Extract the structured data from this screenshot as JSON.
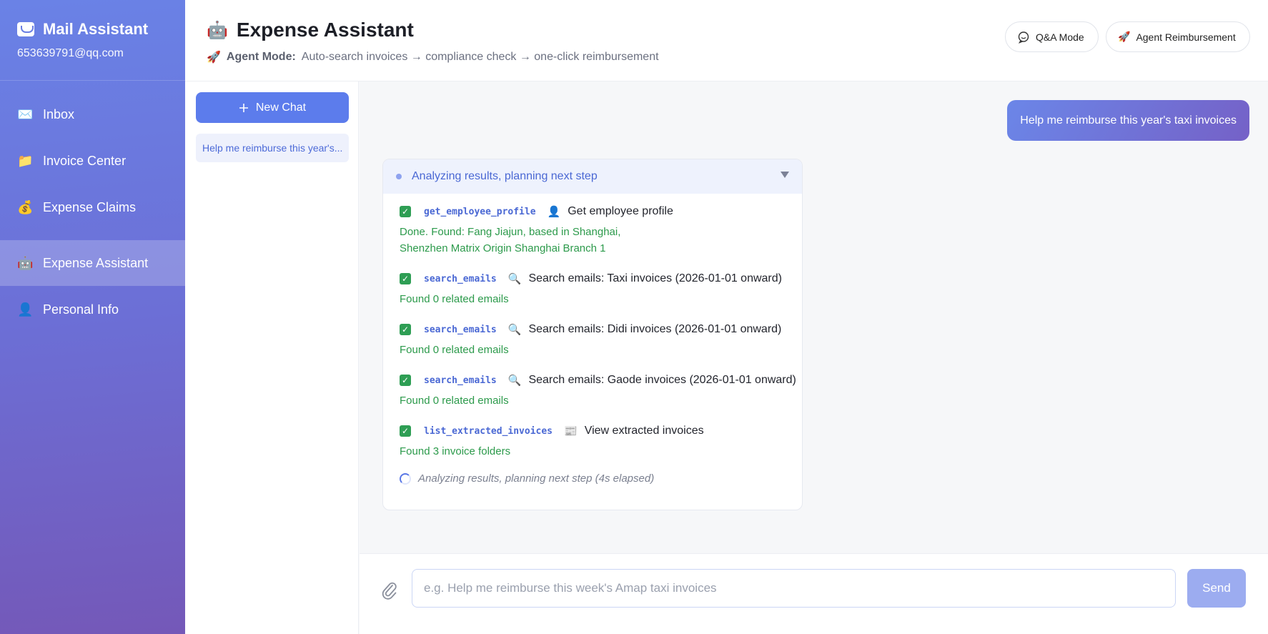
{
  "sidebar": {
    "title": "Mail Assistant",
    "email": "653639791@qq.com",
    "items": [
      {
        "label": "Inbox",
        "icon": "✉️"
      },
      {
        "label": "Invoice Center",
        "icon": "📁"
      },
      {
        "label": "Expense Claims",
        "icon": "💰"
      },
      {
        "label": "Expense Assistant",
        "icon": "🤖"
      },
      {
        "label": "Personal Info",
        "icon": "👤"
      }
    ]
  },
  "header": {
    "icon": "🤖",
    "title": "Expense Assistant",
    "subtitle_icon": "🚀",
    "subtitle_bold": "Agent Mode:",
    "subtitle_text": "Auto-search invoices → compliance check → one-click reimbursement",
    "qa_label": "Q&A Mode",
    "agent_icon": "🚀",
    "agent_label": "Agent Reimbursement"
  },
  "chatlist": {
    "new_chat": "New Chat",
    "entries": [
      "Help me reimburse this year's taxi invoices"
    ]
  },
  "chat": {
    "user_message": "Help me reimburse this year's taxi invoices",
    "card_header": "Analyzing results, planning next step",
    "steps": [
      {
        "tool": "get_employee_profile",
        "icon": "👤",
        "desc": "Get employee profile",
        "result_lines": [
          "Done. Found: Fang Jiajun, based in Shanghai,",
          "Shenzhen Matrix Origin Shanghai Branch 1"
        ]
      },
      {
        "tool": "search_emails",
        "icon": "🔍",
        "desc": "Search emails: Taxi invoices (2026-01-01 onward)",
        "result_lines": [
          "Found 0 related emails"
        ]
      },
      {
        "tool": "search_emails",
        "icon": "🔍",
        "desc": "Search emails: Didi invoices (2026-01-01 onward)",
        "result_lines": [
          "Found 0 related emails"
        ]
      },
      {
        "tool": "search_emails",
        "icon": "🔍",
        "desc": "Search emails: Gaode invoices (2026-01-01 onward)",
        "result_lines": [
          "Found 0 related emails"
        ]
      },
      {
        "tool": "list_extracted_invoices",
        "icon": "📰",
        "desc": "View extracted invoices",
        "result_lines": [
          "Found 3 invoice folders"
        ]
      }
    ],
    "thinking": "Analyzing results, planning next step (4s elapsed)"
  },
  "composer": {
    "placeholder": "e.g. Help me reimburse this week's Amap taxi invoices",
    "send_label": "Send"
  }
}
